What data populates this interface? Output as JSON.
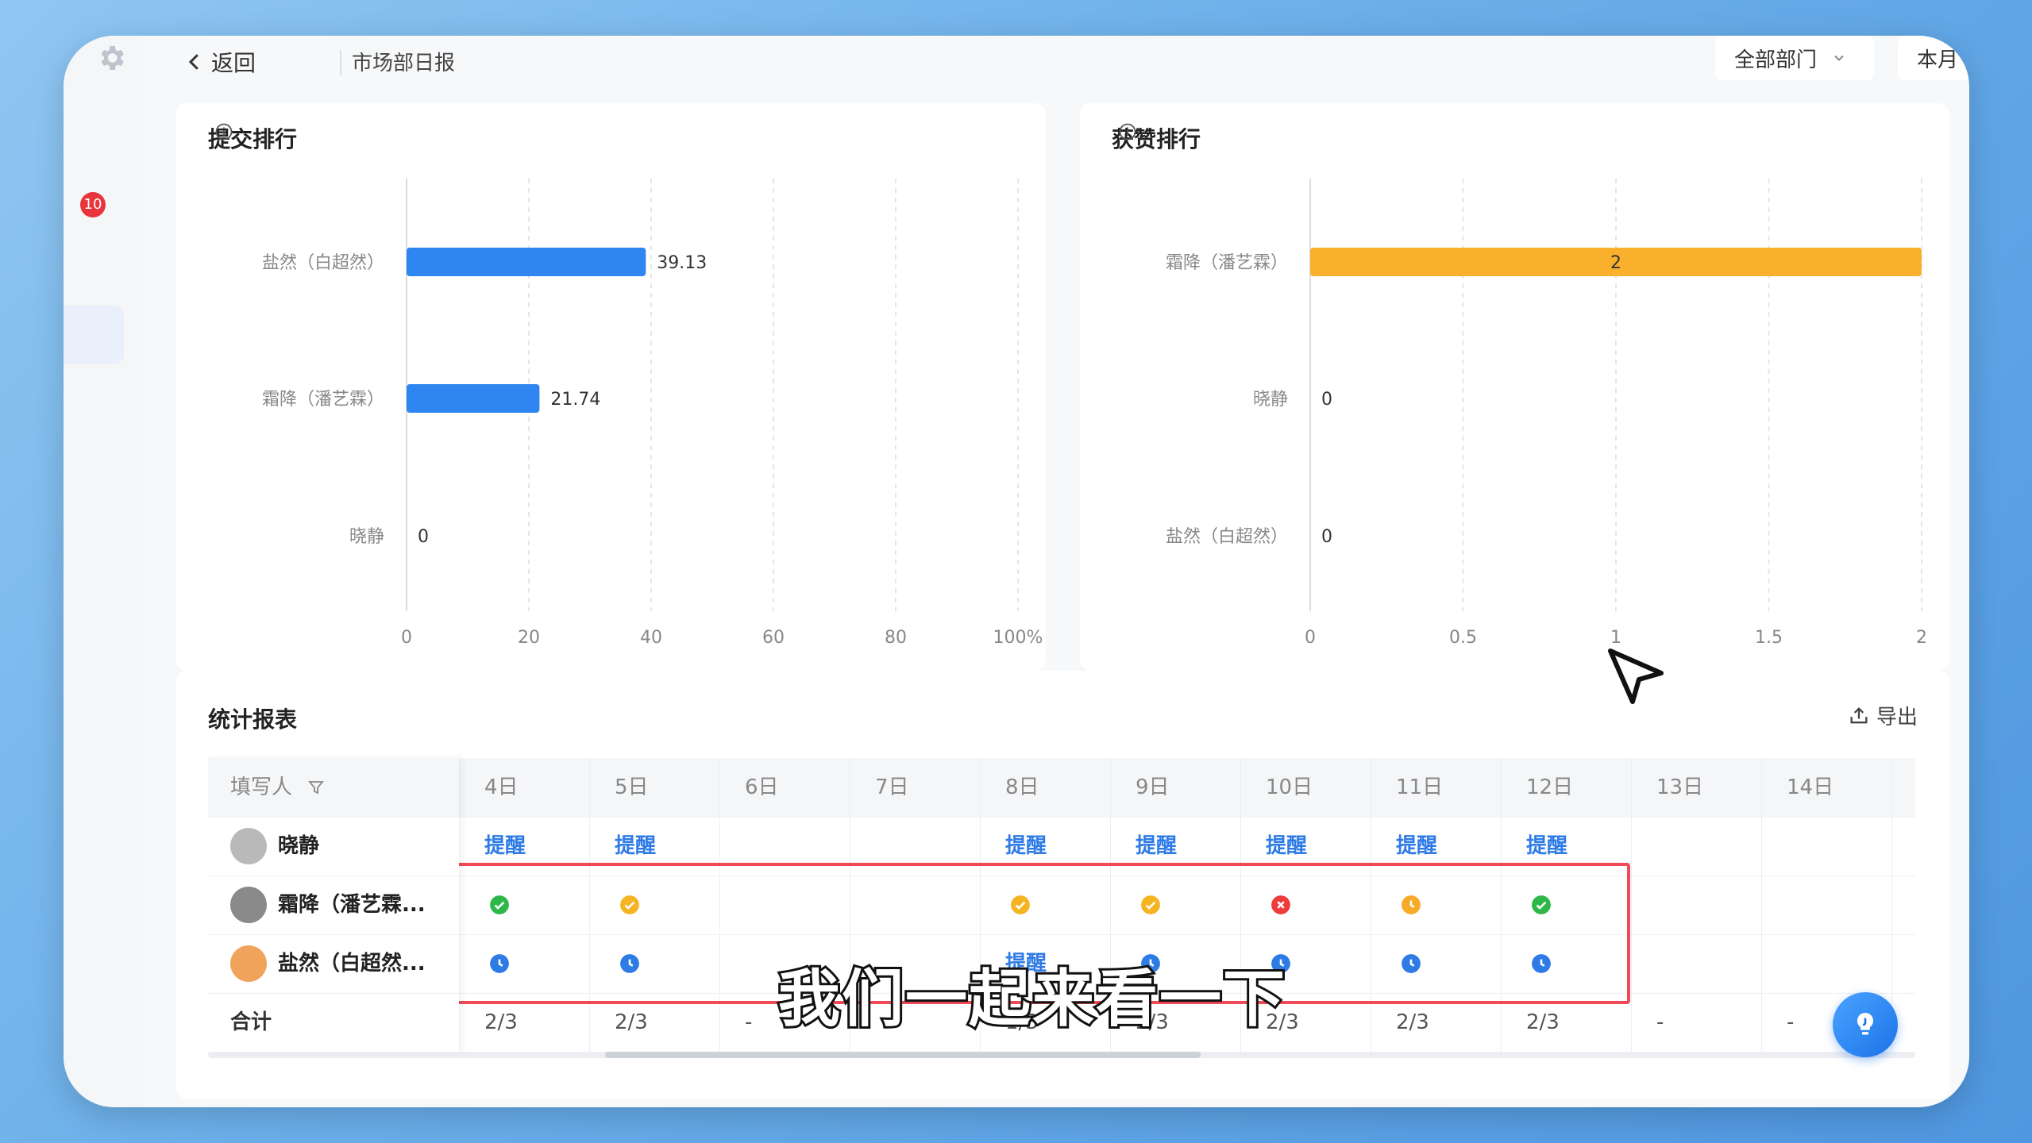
{
  "sidebar": {
    "badge_count": "10"
  },
  "header": {
    "back_label": "返回",
    "breadcrumb": "市场部日报",
    "dept_select": "全部部门",
    "period_select": "本月"
  },
  "submit_rank": {
    "title": "提交排行",
    "chart_data": {
      "type": "bar",
      "orientation": "horizontal",
      "categories": [
        "盐然（白超然）",
        "霜降（潘艺霖）",
        "晓静"
      ],
      "values": [
        39.13,
        21.74,
        0
      ],
      "value_labels": [
        "39.13",
        "21.74",
        "0"
      ],
      "xlim": [
        0,
        100
      ],
      "xticks": [
        "0",
        "20",
        "40",
        "60",
        "80",
        "100%"
      ],
      "color": "#2f86f0"
    }
  },
  "like_rank": {
    "title": "获赞排行",
    "chart_data": {
      "type": "bar",
      "orientation": "horizontal",
      "categories": [
        "霜降（潘艺霖）",
        "晓静",
        "盐然（白超然）"
      ],
      "values": [
        2,
        0,
        0
      ],
      "value_labels": [
        "2",
        "0",
        "0"
      ],
      "xlim": [
        0,
        2
      ],
      "xticks": [
        "0",
        "0.5",
        "1",
        "1.5",
        "2"
      ],
      "color": "#fbb02d"
    }
  },
  "stats": {
    "title": "统计报表",
    "export_label": "导出",
    "filler_header": "填写人",
    "dates": [
      "4日",
      "5日",
      "6日",
      "7日",
      "8日",
      "9日",
      "10日",
      "11日",
      "12日",
      "13日",
      "14日"
    ],
    "rows": [
      {
        "name": "晓静",
        "cells": [
          "提醒",
          "提醒",
          "",
          "",
          "提醒",
          "提醒",
          "提醒",
          "提醒",
          "提醒",
          "",
          ""
        ]
      },
      {
        "name": "霜降（潘艺霖...",
        "cells": [
          "ok",
          "late",
          "",
          "",
          "late",
          "late",
          "miss",
          "pending",
          "ok",
          "",
          ""
        ]
      },
      {
        "name": "盐然（白超然...",
        "cells": [
          "clock",
          "clock",
          "",
          "",
          "提醒",
          "clock",
          "clock",
          "clock",
          "clock",
          "",
          ""
        ]
      }
    ],
    "total_label": "合计",
    "totals": [
      "2/3",
      "2/3",
      "-",
      "",
      "1/3",
      "2/3",
      "2/3",
      "2/3",
      "2/3",
      "-",
      "-"
    ]
  },
  "remind_label": "提醒",
  "subtitle_text": "我们一起来看一下",
  "colors": {
    "ok": "#2eb84a",
    "late": "#f5b421",
    "miss": "#ee3b3b",
    "pending": "#f7a928",
    "clock": "#2f7be6",
    "link": "#2f7be6"
  }
}
